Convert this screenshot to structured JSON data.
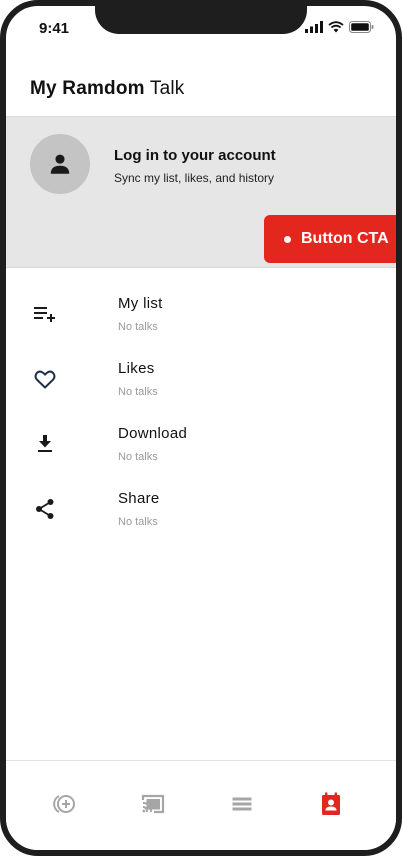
{
  "status_bar": {
    "time": "9:41"
  },
  "header": {
    "title_bold": "My Ramdom",
    "title_rest": " Talk"
  },
  "account": {
    "title": "Log in to your account",
    "subtitle": "Sync my list, likes, and history",
    "cta_label": "Button CTA"
  },
  "menu": {
    "items": [
      {
        "label": "My list",
        "sub": "No talks",
        "icon": "playlist-add-icon"
      },
      {
        "label": "Likes",
        "sub": "No talks",
        "icon": "heart-icon"
      },
      {
        "label": "Download",
        "sub": "No talks",
        "icon": "download-icon"
      },
      {
        "label": "Share",
        "sub": "No talks",
        "icon": "share-icon"
      }
    ]
  },
  "tab_bar": {
    "tabs": [
      {
        "icon": "add-circle-icon",
        "active": false
      },
      {
        "icon": "cast-icon",
        "active": false
      },
      {
        "icon": "list-icon",
        "active": false
      },
      {
        "icon": "contact-book-icon",
        "active": true
      }
    ]
  },
  "colors": {
    "accent": "#e3271f",
    "inactive_icon": "#a6a6a6",
    "account_bg": "#e6e6e6"
  }
}
